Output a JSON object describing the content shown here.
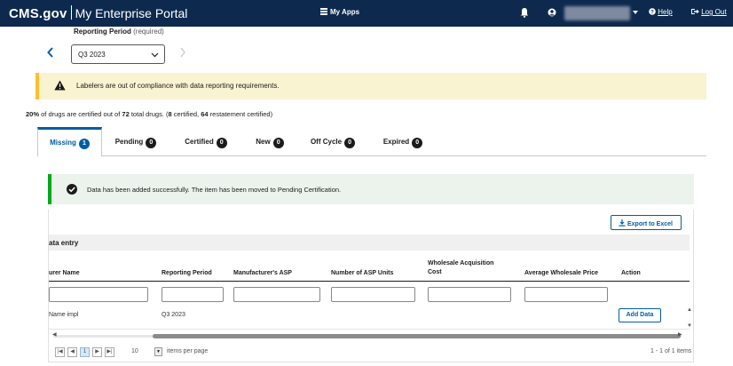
{
  "header": {
    "brand": "CMS.gov",
    "portal": "My Enterprise Portal",
    "my_apps": "My Apps",
    "help": "Help",
    "logout": "Log Out"
  },
  "reporting_period": {
    "label": "Reporting Period",
    "required": "(required)",
    "selected": "Q3 2023"
  },
  "alert_warning": {
    "text": "Labelers are out of compliance with data reporting requirements."
  },
  "summary": {
    "percent": "20%",
    "middle": " of drugs are certified out of ",
    "total": "72",
    "after_total": " total drugs. (",
    "certified": "8",
    "certified_label": " certified, ",
    "restatement": "64",
    "restatement_label": " restatement certified)"
  },
  "tabs": [
    {
      "label": "Missing",
      "count": "1",
      "active": true
    },
    {
      "label": "Pending",
      "count": "0"
    },
    {
      "label": "Certified",
      "count": "0"
    },
    {
      "label": "New",
      "count": "0"
    },
    {
      "label": "Off Cycle",
      "count": "0"
    },
    {
      "label": "Expired",
      "count": "0"
    }
  ],
  "alert_success": {
    "text": "Data has been added successfully. The item has been moved to Pending Certification."
  },
  "table": {
    "export_label": "Export to Excel",
    "section_title": "ata entry",
    "columns": {
      "name": "urer Name",
      "period": "Reporting Period",
      "asp": "Manufacturer's ASP",
      "units": "Number of ASP Units",
      "wac_1": "Wholesale Acquisition",
      "wac_2": "Cost",
      "awp": "Average Wholesale Price",
      "action": "Action"
    },
    "rows": [
      {
        "name": "Name impl",
        "period": "Q3 2023",
        "action": "Add Data"
      }
    ]
  },
  "pager": {
    "current_page": "1",
    "page_size": "10",
    "per_page_label": "items per page",
    "count_label": "1 - 1 of 1 items"
  },
  "colors": {
    "header_bg": "#0d2a4e",
    "accent": "#005ea2",
    "warning": "#ffbe2e",
    "success": "#00a91c"
  }
}
